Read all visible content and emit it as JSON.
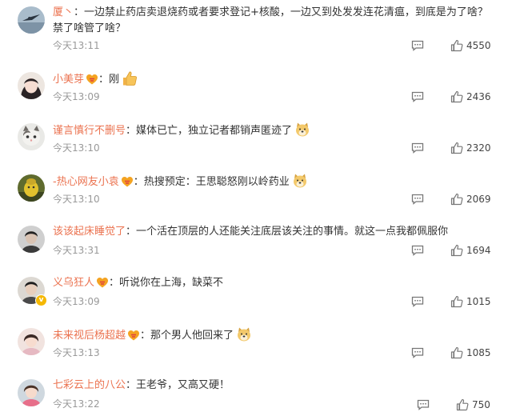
{
  "comments": [
    {
      "user": "厦丶",
      "text": "一边禁止药店卖退烧药或者要求登记+核酸，一边又到处发发连花清瘟，到底是为了啥？禁了啥管了啥？",
      "time": "今天13:11",
      "likes": "4550",
      "emoji": ""
    },
    {
      "user": "小美芽",
      "text": "刚",
      "time": "今天13:09",
      "likes": "2436",
      "emoji": "thumbs-up-icon"
    },
    {
      "user": "谨言慎行不删号",
      "text": "媒体已亡，独立记者都销声匿迹了",
      "time": "今天13:10",
      "likes": "2320",
      "emoji": "doge-icon"
    },
    {
      "user": "-热心网友小袁",
      "text": "热搜预定：王思聪怒刚以岭药业",
      "time": "今天13:10",
      "likes": "2069",
      "emoji": "doge-icon"
    },
    {
      "user": "该该起床睡觉了",
      "text": "一个活在顶层的人还能关注底层该关注的事情。就这一点我都佩服你",
      "time": "今天13:31",
      "likes": "1694",
      "emoji": ""
    },
    {
      "user": "义乌狂人",
      "text": "听说你在上海，缺菜不",
      "time": "今天13:09",
      "likes": "1015",
      "emoji": ""
    },
    {
      "user": "未来视后杨超越",
      "text": "那个男人他回来了",
      "time": "今天13:13",
      "likes": "1085",
      "emoji": "doge-icon"
    },
    {
      "user": "七彩云上的八公",
      "text": "王老爷，又高又硬！",
      "time": "今天13:22",
      "likes": "750",
      "emoji": ""
    }
  ],
  "colors": {
    "username": "#eb7350",
    "meta": "#999999",
    "text": "#333333"
  }
}
